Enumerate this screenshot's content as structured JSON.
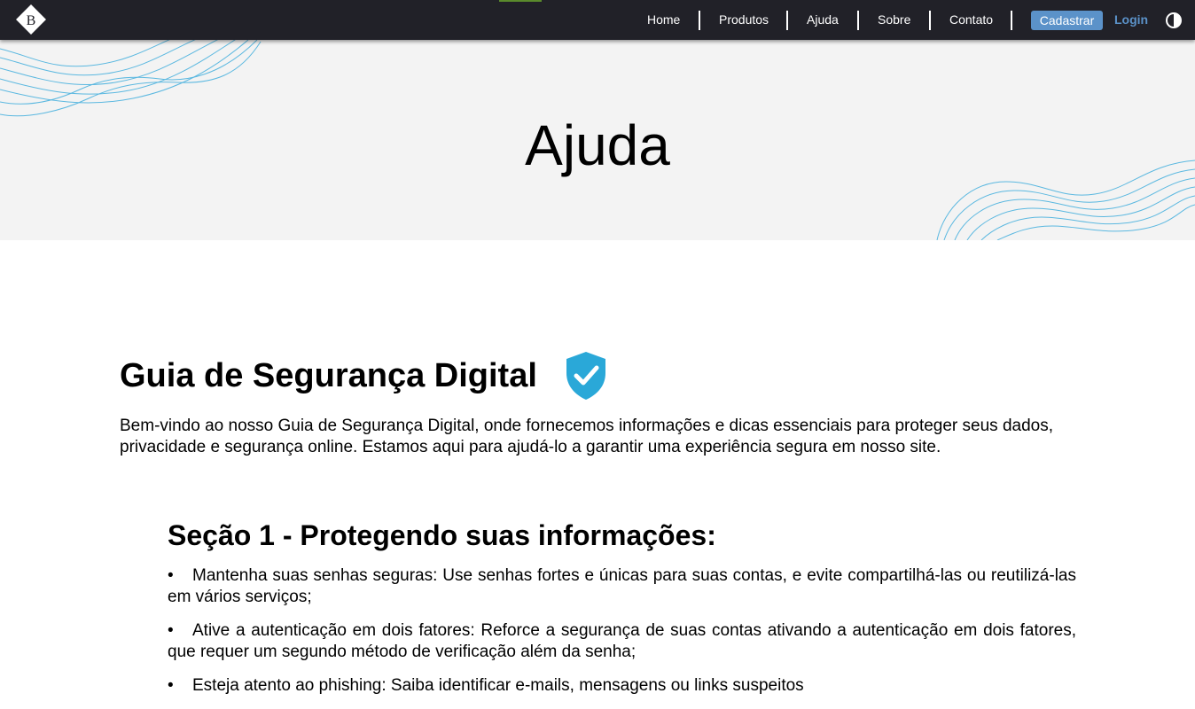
{
  "nav": {
    "links": [
      "Home",
      "Produtos",
      "Ajuda",
      "Sobre",
      "Contato"
    ],
    "cadastrar": "Cadastrar",
    "login": "Login",
    "logo_letter": "B"
  },
  "hero": {
    "title": "Ajuda"
  },
  "guide": {
    "title": "Guia de Segurança Digital",
    "intro": "Bem-vindo ao nosso Guia de Segurança Digital, onde fornecemos informações e dicas essenciais para proteger seus dados, privacidade e segurança online. Estamos aqui para ajudá-lo a garantir uma experiência segura em nosso site."
  },
  "section1": {
    "title": "Seção 1 - Protegendo suas informações:",
    "tips": [
      "Mantenha suas senhas seguras: Use senhas fortes e únicas para suas contas, e evite compartilhá-las ou reutilizá-las em vários serviços;",
      "Ative a autenticação em dois fatores: Reforce a segurança de suas contas ativando a autenticação em dois fatores, que requer um segundo método de verificação além da senha;",
      "Esteja atento ao phishing: Saiba identificar e-mails, mensagens ou links suspeitos"
    ]
  },
  "colors": {
    "navbar": "#212128",
    "accent": "#5b92c9",
    "hero_bg": "#f3f3f3",
    "shield": "#2aa8d8",
    "wave": "#5bb8e0"
  }
}
